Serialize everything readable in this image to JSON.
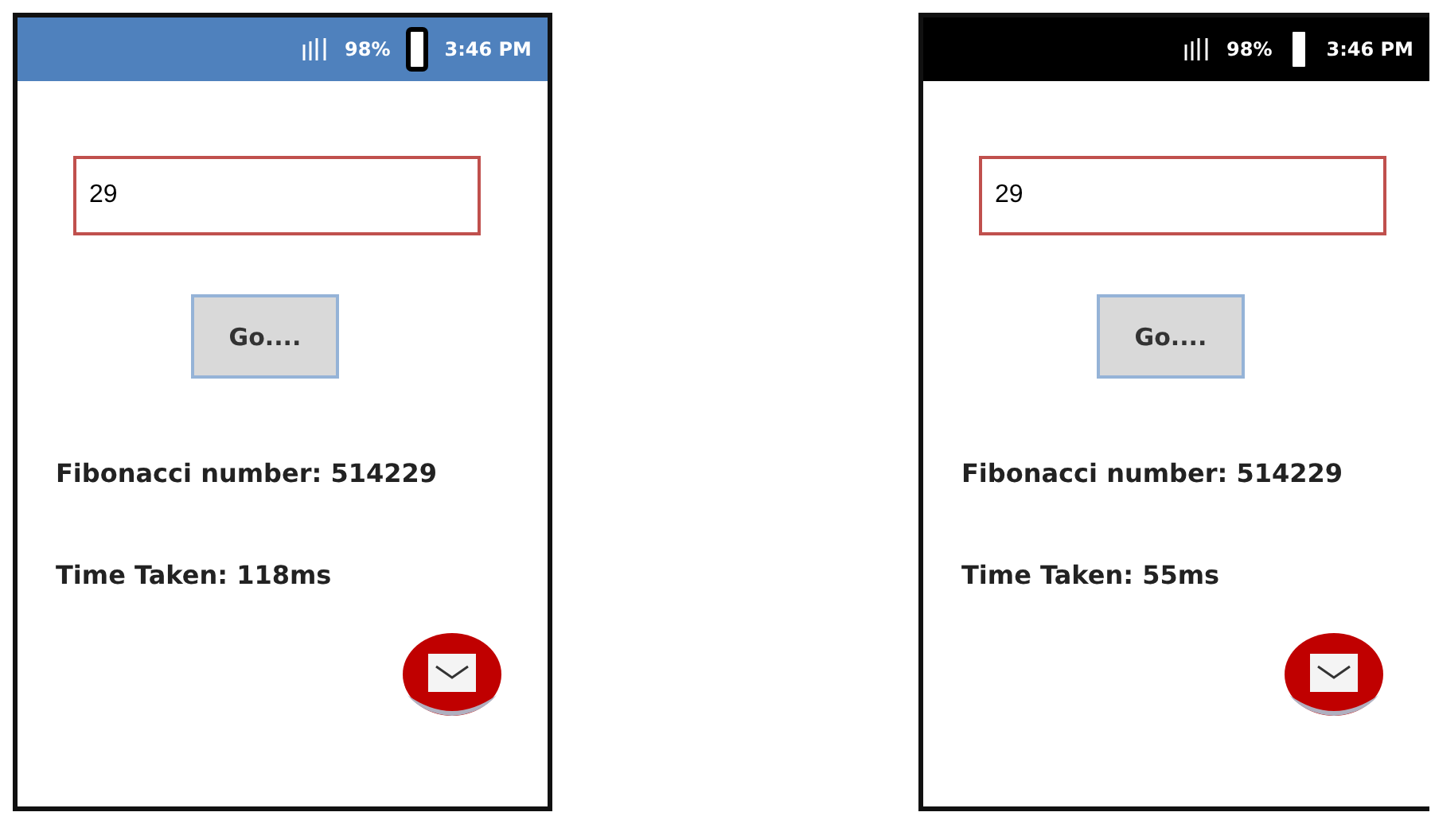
{
  "phones": [
    {
      "status_bar": {
        "color": "#4f81bd",
        "battery": "98%",
        "time": "3:46 PM"
      },
      "input": {
        "value": "29"
      },
      "button": "Go....",
      "result": "Fibonacci number: 514229",
      "time_taken": "Time Taken: 118ms"
    },
    {
      "status_bar": {
        "color": "#000000",
        "battery": "98%",
        "time": "3:46 PM"
      },
      "input": {
        "value": "29"
      },
      "button": "Go....",
      "result": "Fibonacci number: 514229",
      "time_taken": "Time Taken: 55ms"
    }
  ]
}
